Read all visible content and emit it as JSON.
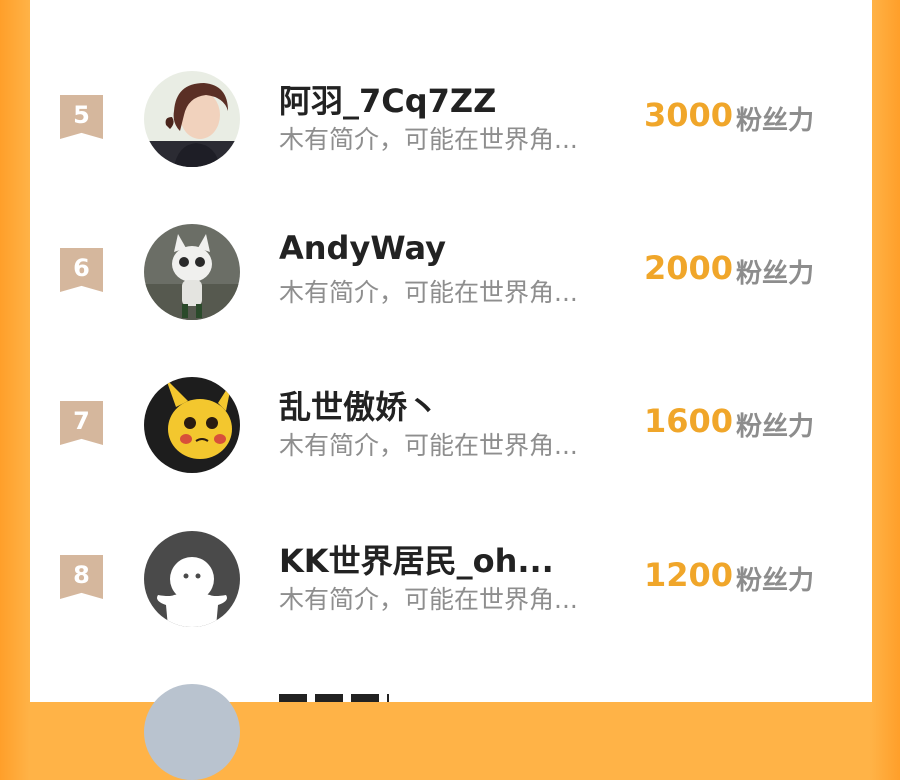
{
  "ranking": {
    "unit_label": "粉丝力",
    "entries": [
      {
        "rank": "5",
        "name": "阿羽_7Cq7ZZ",
        "bio": "木有简介，可能在世界角...",
        "score": "3000",
        "avatar": "photo-woman-avatar"
      },
      {
        "rank": "6",
        "name": "AndyWay",
        "bio": "木有简介，可能在世界角...",
        "score": "2000",
        "avatar": "cartoon-cat-avatar"
      },
      {
        "rank": "7",
        "name": "乱世傲娇丶",
        "bio": "木有简介，可能在世界角...",
        "score": "1600",
        "avatar": "pikachu-avatar"
      },
      {
        "rank": "8",
        "name": "KK世界居民_oh...",
        "bio": "木有简介，可能在世界角...",
        "score": "1200",
        "avatar": "default-ghost-avatar"
      }
    ]
  },
  "colors": {
    "background_orange": "#ffb347",
    "rank_badge": "#d5b79d",
    "score": "#f0a62a",
    "name": "#222222",
    "bio": "#8e8e8e"
  }
}
